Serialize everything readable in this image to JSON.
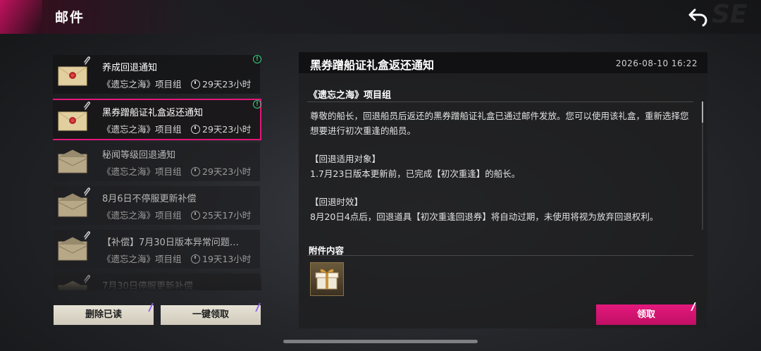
{
  "header": {
    "title": "邮件",
    "back_icon": "back-arrow-icon"
  },
  "mail_list": [
    {
      "title": "养成回退通知",
      "sender": "《遗忘之海》项目组",
      "time_left": "29天23小时",
      "has_attachment": true,
      "is_new": true,
      "selected": false,
      "read": false,
      "icon": "sealed-envelope-icon"
    },
    {
      "title": "黑券蹭船证礼盒返还通知",
      "sender": "《遗忘之海》项目组",
      "time_left": "29天23小时",
      "has_attachment": true,
      "is_new": true,
      "selected": true,
      "read": false,
      "icon": "sealed-envelope-icon"
    },
    {
      "title": "秘闻等级回退通知",
      "sender": "《遗忘之海》项目组",
      "time_left": "29天23小时",
      "has_attachment": false,
      "is_new": false,
      "selected": false,
      "read": true,
      "icon": "opened-envelope-icon"
    },
    {
      "title": "8月6日不停服更新补偿",
      "sender": "《遗忘之海》项目组",
      "time_left": "25天17小时",
      "has_attachment": true,
      "is_new": false,
      "selected": false,
      "read": true,
      "icon": "opened-envelope-icon"
    },
    {
      "title": "【补偿】7月30日版本异常问题…",
      "sender": "《遗忘之海》项目组",
      "time_left": "19天13小时",
      "has_attachment": true,
      "is_new": false,
      "selected": false,
      "read": true,
      "icon": "opened-envelope-icon"
    },
    {
      "title": "7月30日停服更新补偿",
      "sender": "",
      "time_left": "",
      "has_attachment": true,
      "is_new": false,
      "selected": false,
      "read": true,
      "icon": "opened-envelope-icon"
    }
  ],
  "buttons": {
    "delete_read": "删除已读",
    "claim_all": "一键领取",
    "claim": "领取"
  },
  "detail": {
    "title": "黑券蹭船证礼盒返还通知",
    "date": "2026-08-10 16:22",
    "sender": "《遗忘之海》项目组",
    "body": [
      "尊敬的船长，回退船员后返还的黑券蹭船证礼盒已通过邮件发放。您可以使用该礼盒，重新选择您想要进行初次重逢的船员。",
      "",
      "【回退适用对象】",
      "1.7月23日版本更新前，已完成【初次重逢】的船长。",
      "",
      "【回退时效】",
      "8月20日4点后，回退道具【初次重逢回退券】将自动过期，未使用将视为放弃回退权利。"
    ],
    "attachments_label": "附件内容",
    "attachments": [
      {
        "icon": "gift-box-icon"
      }
    ]
  },
  "colors": {
    "accent": "#e0177a",
    "new_indicator": "#36d27a"
  }
}
